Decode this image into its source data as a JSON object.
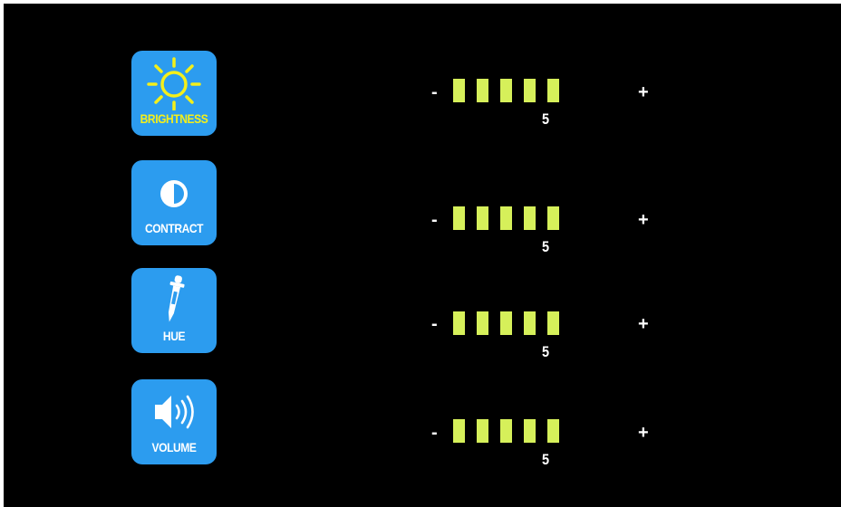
{
  "colors": {
    "background": "#000000",
    "tile": "#2c9cef",
    "bar_fill": "#d6f05a",
    "brightness_label": "#f4ef1a",
    "text": "#ffffff"
  },
  "controls": [
    {
      "id": "brightness",
      "label": "BRIGHTNESS",
      "icon": "sun-icon",
      "value": "5",
      "segments_filled": 5,
      "segments_total": 5,
      "minus_label": "-",
      "plus_label": "+"
    },
    {
      "id": "contrast",
      "label": "CONTRACT",
      "icon": "contrast-icon",
      "value": "5",
      "segments_filled": 5,
      "segments_total": 5,
      "minus_label": "-",
      "plus_label": "+"
    },
    {
      "id": "hue",
      "label": "HUE",
      "icon": "dropper-icon",
      "value": "5",
      "segments_filled": 5,
      "segments_total": 5,
      "minus_label": "-",
      "plus_label": "+"
    },
    {
      "id": "volume",
      "label": "VOLUME",
      "icon": "speaker-icon",
      "value": "5",
      "segments_filled": 5,
      "segments_total": 5,
      "minus_label": "-",
      "plus_label": "+"
    }
  ]
}
